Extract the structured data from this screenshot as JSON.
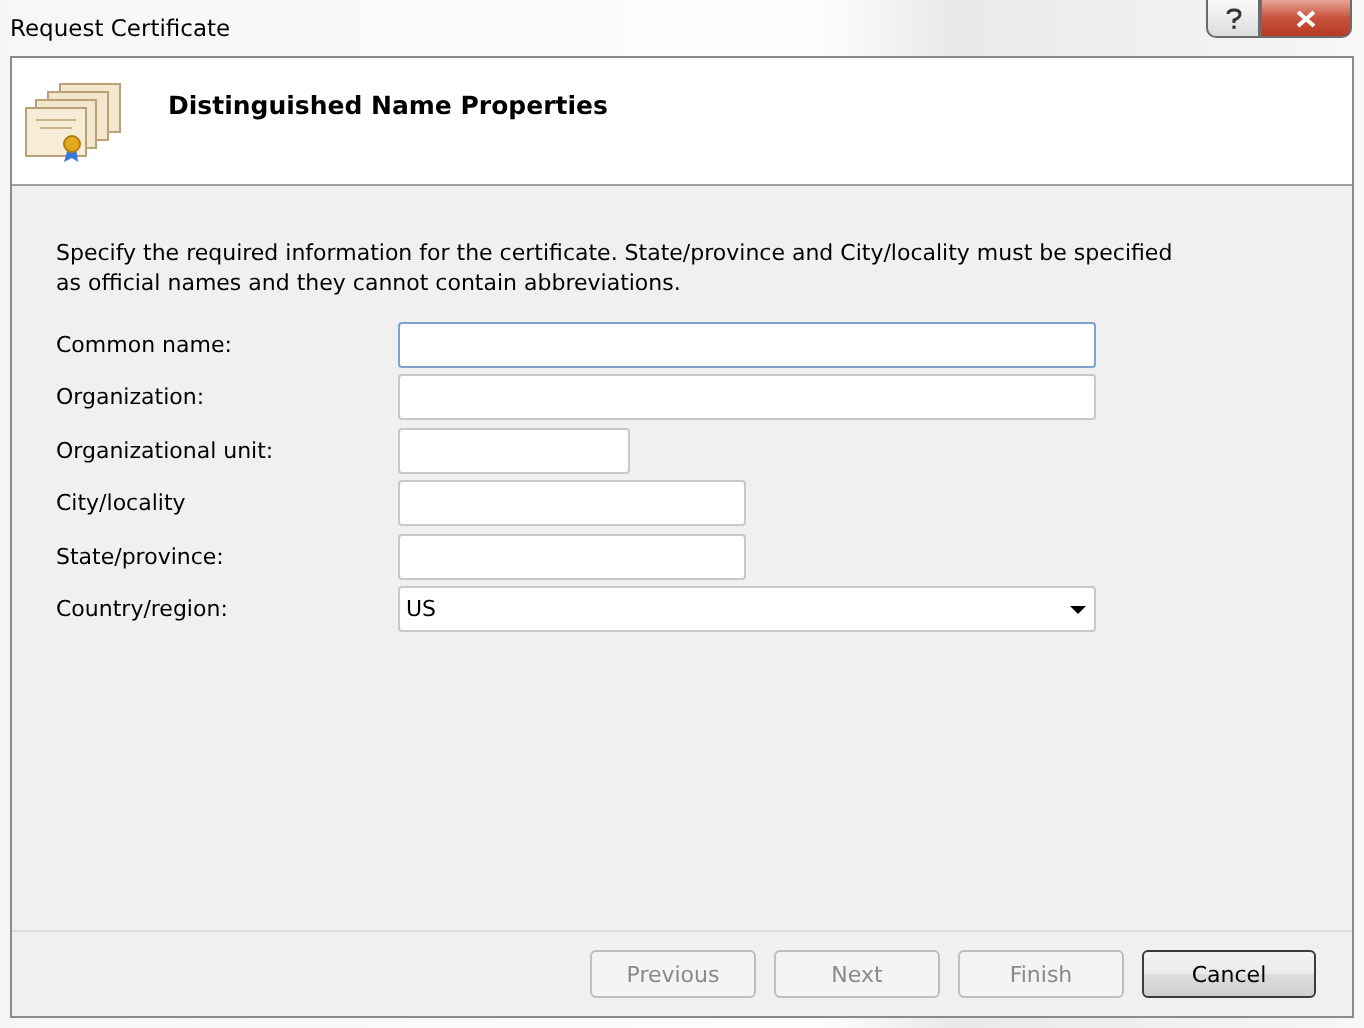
{
  "window": {
    "title": "Request Certificate"
  },
  "header": {
    "title": "Distinguished Name Properties"
  },
  "instructions": "Specify the required information for the certificate. State/province and City/locality must be specified as official names and they cannot contain abbreviations.",
  "fields": [
    {
      "kind": "text",
      "label": "Common name:",
      "focused": true
    },
    {
      "kind": "text",
      "label": "Organization:",
      "focused": false
    },
    {
      "kind": "text",
      "label": "Organizational unit:",
      "focused": false
    },
    {
      "kind": "text",
      "label": "City/locality",
      "focused": false
    },
    {
      "kind": "text",
      "label": "State/province:",
      "focused": false
    },
    {
      "kind": "dropdown",
      "label": "Country/region:",
      "value": "US",
      "focused": false
    }
  ],
  "buttons": [
    {
      "label": "Previous",
      "disabled": true,
      "default": false
    },
    {
      "label": "Next",
      "disabled": true,
      "default": false
    },
    {
      "label": "Finish",
      "disabled": true,
      "default": false
    },
    {
      "label": "Cancel",
      "disabled": false,
      "default": true
    }
  ]
}
